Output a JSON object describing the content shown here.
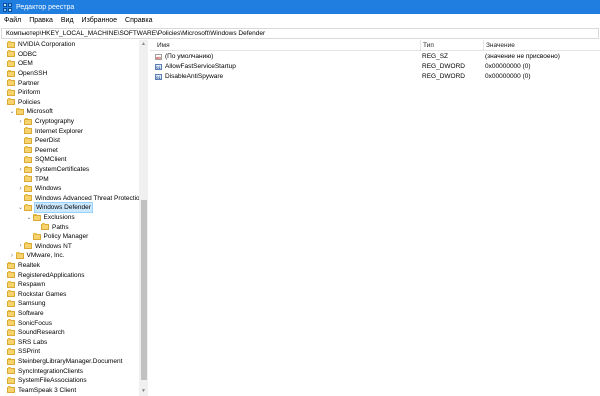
{
  "window": {
    "title": "Редактор реестра"
  },
  "menu": [
    "Файл",
    "Правка",
    "Вид",
    "Избранное",
    "Справка"
  ],
  "address": "Компьютер\\HKEY_LOCAL_MACHINE\\SOFTWARE\\Policies\\Microsoft\\Windows Defender",
  "tree": [
    {
      "label": "NVIDIA Corporation",
      "depth": 0,
      "expand": ""
    },
    {
      "label": "ODBC",
      "depth": 0,
      "expand": ""
    },
    {
      "label": "OEM",
      "depth": 0,
      "expand": ""
    },
    {
      "label": "OpenSSH",
      "depth": 0,
      "expand": ""
    },
    {
      "label": "Partner",
      "depth": 0,
      "expand": ""
    },
    {
      "label": "Piriform",
      "depth": 0,
      "expand": ""
    },
    {
      "label": "Policies",
      "depth": 0,
      "expand": ""
    },
    {
      "label": "Microsoft",
      "depth": 1,
      "expand": "expanded"
    },
    {
      "label": "Cryptography",
      "depth": 2,
      "expand": "collapsed"
    },
    {
      "label": "Internet Explorer",
      "depth": 2,
      "expand": ""
    },
    {
      "label": "PeerDist",
      "depth": 2,
      "expand": ""
    },
    {
      "label": "Peernet",
      "depth": 2,
      "expand": ""
    },
    {
      "label": "SQMClient",
      "depth": 2,
      "expand": ""
    },
    {
      "label": "SystemCertificates",
      "depth": 2,
      "expand": "collapsed"
    },
    {
      "label": "TPM",
      "depth": 2,
      "expand": ""
    },
    {
      "label": "Windows",
      "depth": 2,
      "expand": "collapsed"
    },
    {
      "label": "Windows Advanced Threat Protection",
      "depth": 2,
      "expand": ""
    },
    {
      "label": "Windows Defender",
      "depth": 2,
      "expand": "expanded",
      "selected": true
    },
    {
      "label": "Exclusions",
      "depth": 3,
      "expand": "expanded"
    },
    {
      "label": "Paths",
      "depth": 4,
      "expand": ""
    },
    {
      "label": "Policy Manager",
      "depth": 3,
      "expand": ""
    },
    {
      "label": "Windows NT",
      "depth": 2,
      "expand": "collapsed"
    },
    {
      "label": "VMware, Inc.",
      "depth": 1,
      "expand": "collapsed"
    },
    {
      "label": "Realtek",
      "depth": 0,
      "expand": ""
    },
    {
      "label": "RegisteredApplications",
      "depth": 0,
      "expand": ""
    },
    {
      "label": "Respawn",
      "depth": 0,
      "expand": ""
    },
    {
      "label": "Rockstar Games",
      "depth": 0,
      "expand": ""
    },
    {
      "label": "Samsung",
      "depth": 0,
      "expand": ""
    },
    {
      "label": "Software",
      "depth": 0,
      "expand": ""
    },
    {
      "label": "SonicFocus",
      "depth": 0,
      "expand": ""
    },
    {
      "label": "SoundResearch",
      "depth": 0,
      "expand": ""
    },
    {
      "label": "SRS Labs",
      "depth": 0,
      "expand": ""
    },
    {
      "label": "SSPrint",
      "depth": 0,
      "expand": ""
    },
    {
      "label": "SteinbergLibraryManager.Document",
      "depth": 0,
      "expand": ""
    },
    {
      "label": "SyncIntegrationClients",
      "depth": 0,
      "expand": ""
    },
    {
      "label": "SystemFileAssociations",
      "depth": 0,
      "expand": ""
    },
    {
      "label": "TeamSpeak 3 Client",
      "depth": 0,
      "expand": ""
    }
  ],
  "list": {
    "headers": {
      "name": "Имя",
      "type": "Тип",
      "data": "Значение"
    },
    "rows": [
      {
        "icon": "string-value-icon",
        "name": "(По умолчанию)",
        "type": "REG_SZ",
        "data": "(значение не присвоено)"
      },
      {
        "icon": "dword-value-icon",
        "name": "AllowFastServiceStartup",
        "type": "REG_DWORD",
        "data": "0x00000000 (0)"
      },
      {
        "icon": "dword-value-icon",
        "name": "DisableAntiSpyware",
        "type": "REG_DWORD",
        "data": "0x00000000 (0)"
      }
    ]
  },
  "colors": {
    "titlebar": "#1f7ee0",
    "selection": "#cce8ff",
    "folder": "#f6d36c"
  }
}
